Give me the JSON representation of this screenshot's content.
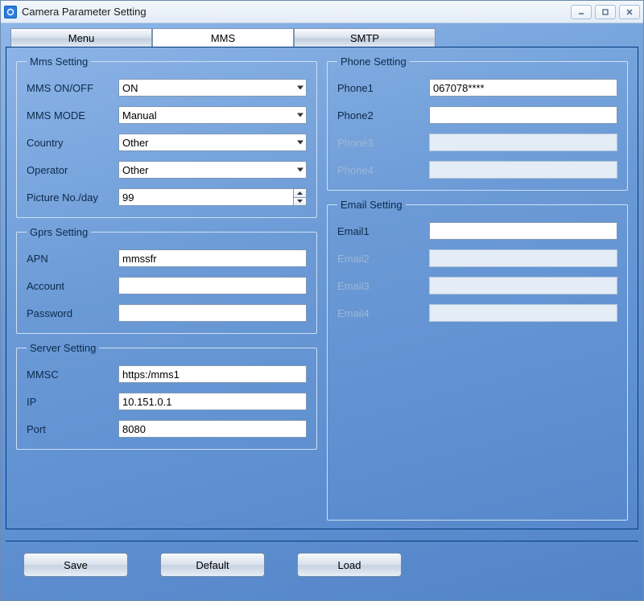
{
  "window": {
    "title": "Camera Parameter Setting"
  },
  "tabs": {
    "menu": "Menu",
    "mms": "MMS",
    "smtp": "SMTP"
  },
  "mms": {
    "legend": "Mms Setting",
    "onoff_label": "MMS ON/OFF",
    "onoff_value": "ON",
    "mode_label": "MMS MODE",
    "mode_value": "Manual",
    "country_label": "Country",
    "country_value": "Other",
    "operator_label": "Operator",
    "operator_value": "Other",
    "picno_label": "Picture No./day",
    "picno_value": "99"
  },
  "gprs": {
    "legend": "Gprs Setting",
    "apn_label": "APN",
    "apn_value": "mmssfr",
    "account_label": "Account",
    "account_value": "",
    "password_label": "Password",
    "password_value": ""
  },
  "server": {
    "legend": "Server Setting",
    "mmsc_label": "MMSC",
    "mmsc_value": "https:/mms1",
    "ip_label": "IP",
    "ip_value": "10.151.0.1",
    "port_label": "Port",
    "port_value": "8080"
  },
  "phone": {
    "legend": "Phone Setting",
    "p1_label": "Phone1",
    "p1_value": "067078****",
    "p2_label": "Phone2",
    "p2_value": "",
    "p3_label": "Phone3",
    "p3_value": "",
    "p4_label": "Phone4",
    "p4_value": ""
  },
  "email": {
    "legend": "Email Setting",
    "e1_label": "Email1",
    "e1_value": "",
    "e2_label": "Email2",
    "e2_value": "",
    "e3_label": "Email3",
    "e3_value": "",
    "e4_label": "Email4",
    "e4_value": ""
  },
  "footer": {
    "save": "Save",
    "default": "Default",
    "load": "Load"
  }
}
